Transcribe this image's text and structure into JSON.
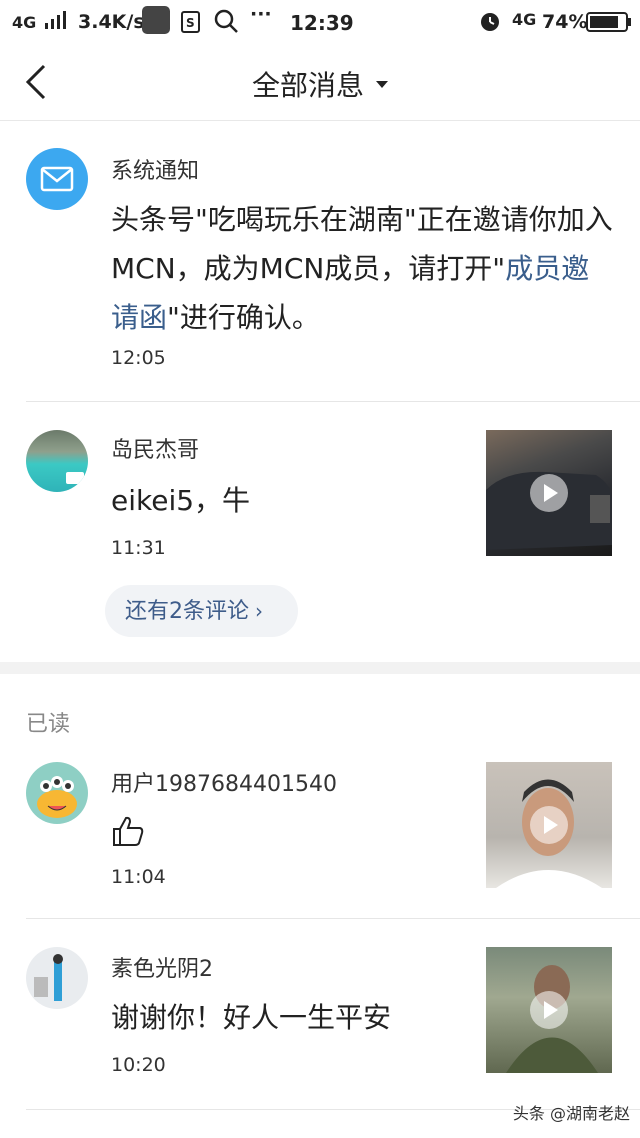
{
  "status": {
    "network": "4G",
    "signal": "ıll",
    "speed": "3.4K/s",
    "time": "12:39",
    "net2": "4G",
    "battery": "74%"
  },
  "nav": {
    "title": "全部消息"
  },
  "system": {
    "name": "系统通知",
    "text_a": "头条号\"吃喝玩乐在湖南\"正在邀请你加入MCN，成为MCN成员，请打开\"",
    "link": "成员邀请函",
    "text_b": "\"进行确认。",
    "time": "12:05"
  },
  "comment1": {
    "name": "岛民杰哥",
    "text": "eikei5，牛",
    "time": "11:31",
    "more": "还有2条评论"
  },
  "read_label": "已读",
  "comment2": {
    "name": "用户1987684401540",
    "time": "11:04"
  },
  "comment3": {
    "name": "素色光阴2",
    "text": "谢谢你！好人一生平安",
    "time": "10:20"
  },
  "watermark": "头条 @湖南老赵",
  "colors": {
    "link": "#3a5e8c",
    "icon_blue": "#3ca8f0"
  }
}
